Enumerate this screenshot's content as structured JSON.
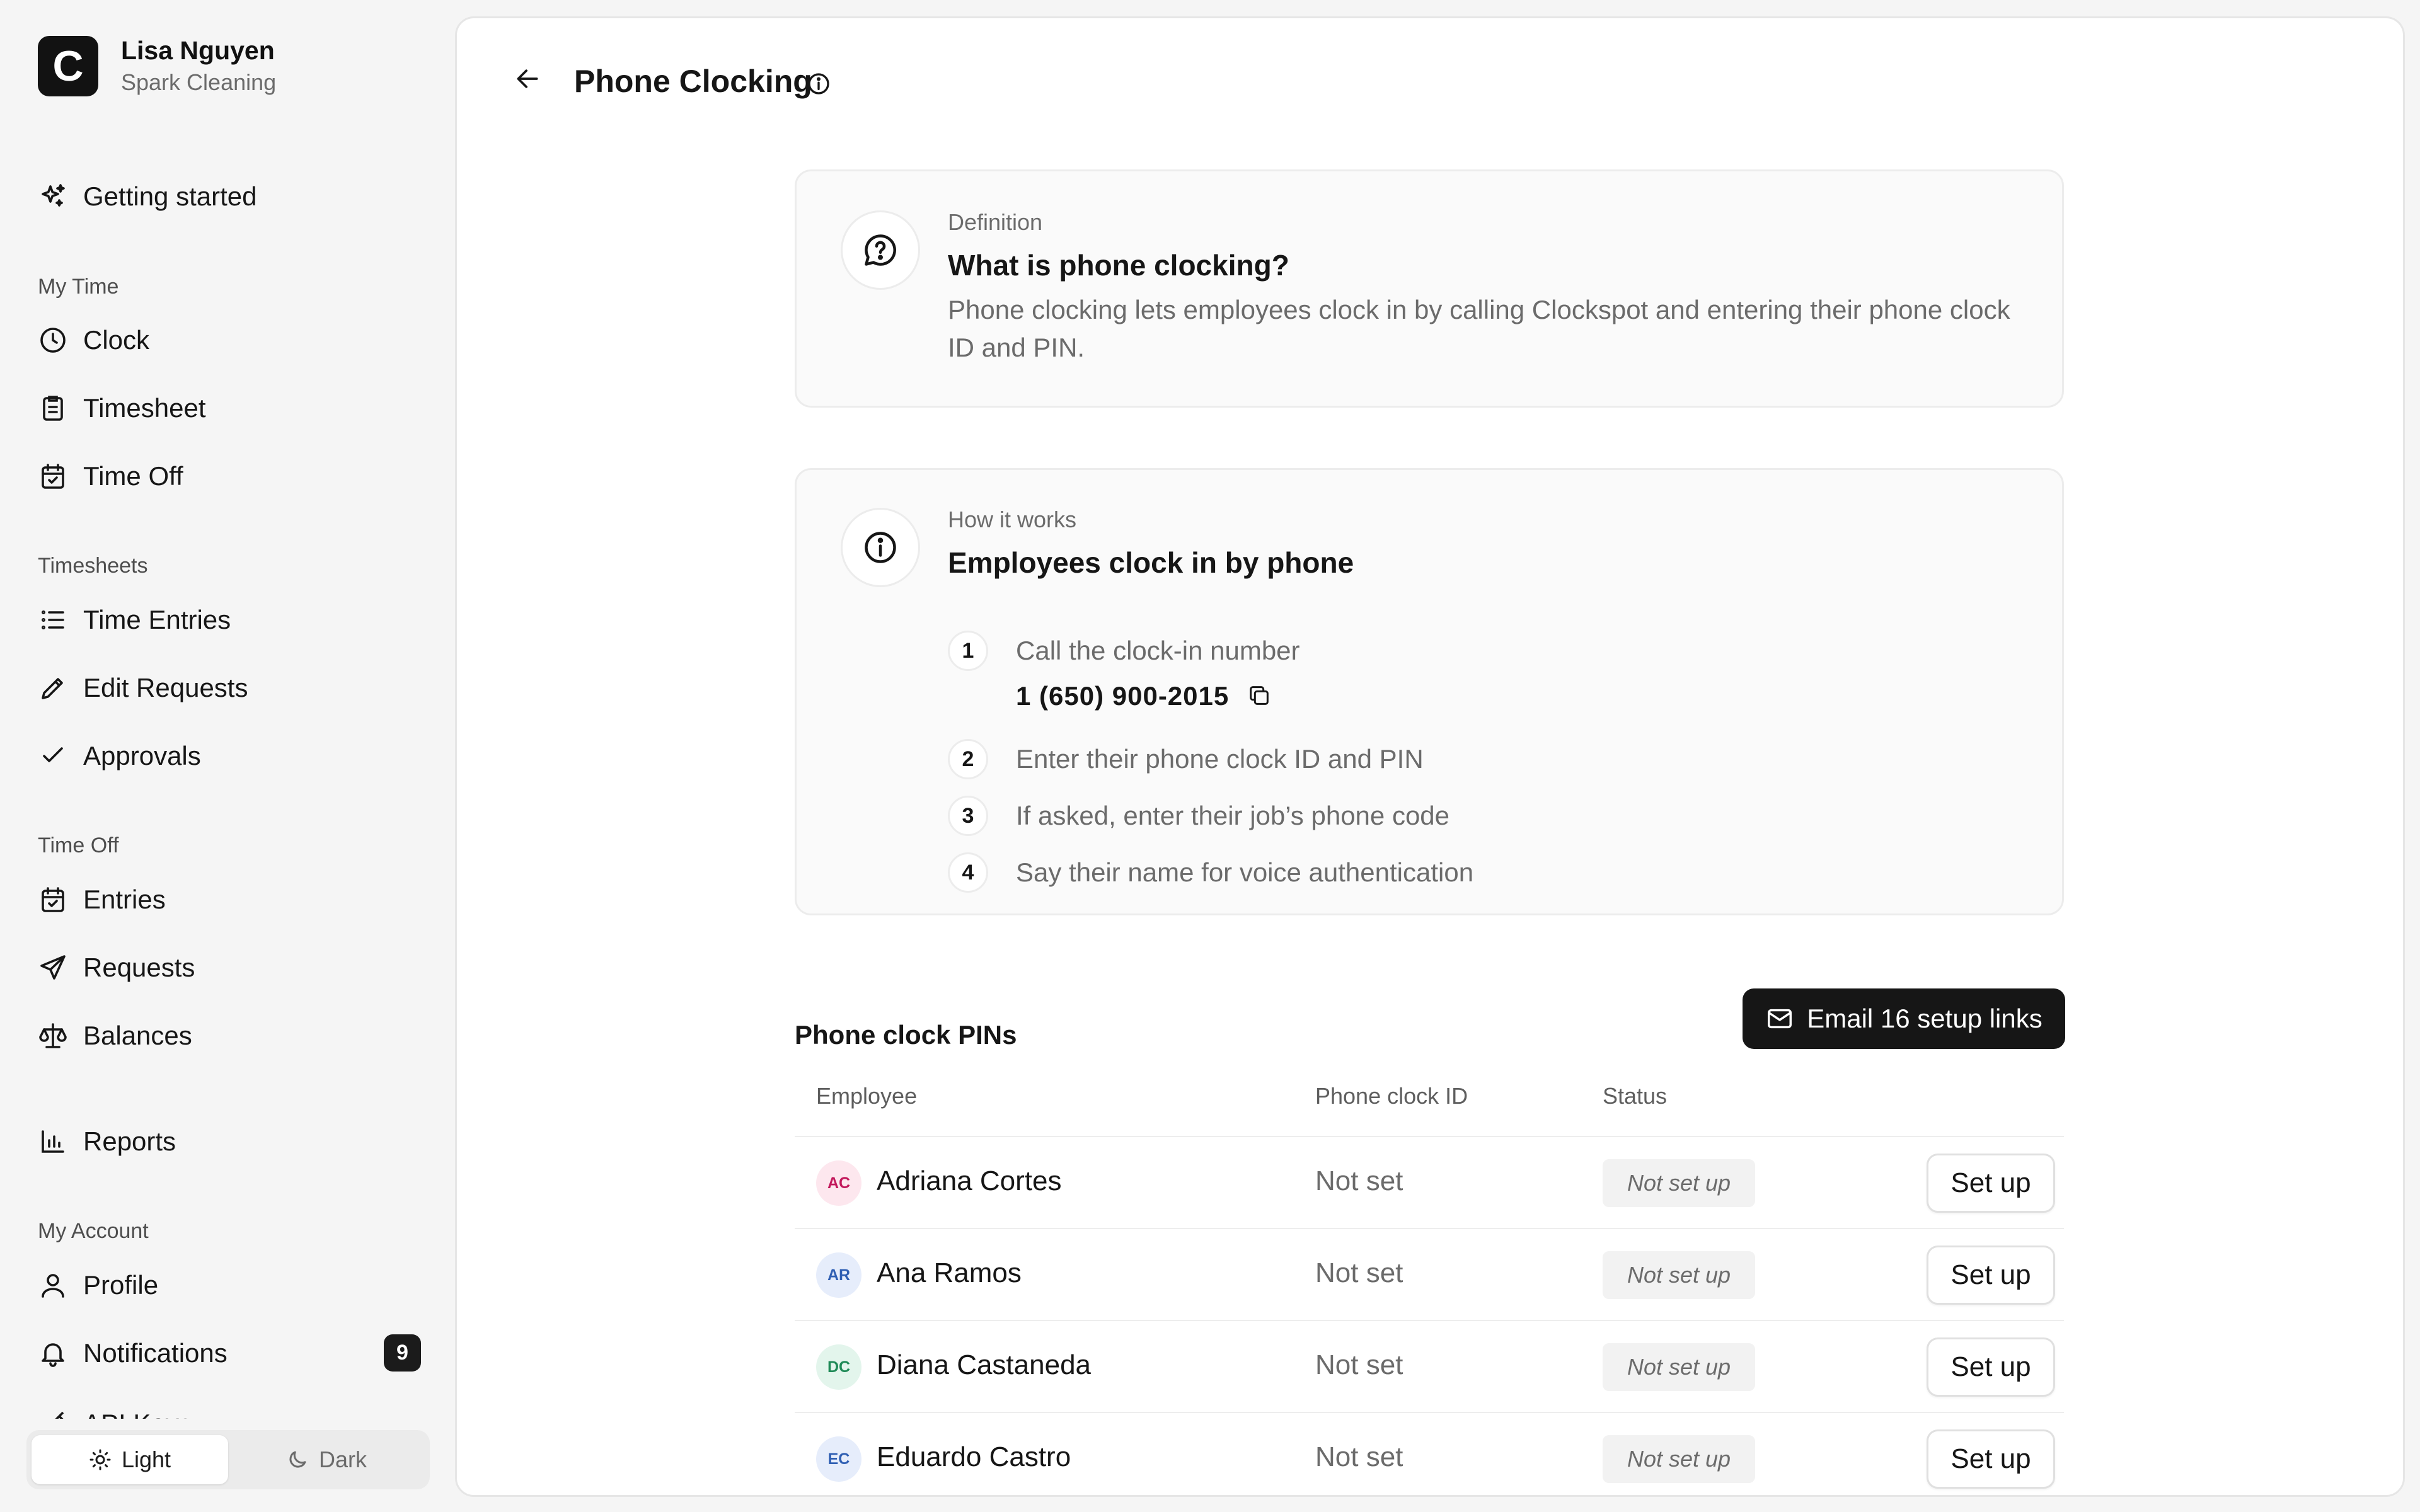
{
  "user": {
    "logo_letter": "C",
    "name": "Lisa Nguyen",
    "company": "Spark Cleaning"
  },
  "sidebar": {
    "getting_started": "Getting started",
    "sections": {
      "my_time": "My Time",
      "timesheets": "Timesheets",
      "time_off": "Time Off",
      "my_account": "My Account"
    },
    "items": {
      "clock": "Clock",
      "timesheet": "Timesheet",
      "time_off": "Time Off",
      "time_entries": "Time Entries",
      "edit_requests": "Edit Requests",
      "approvals": "Approvals",
      "entries": "Entries",
      "requests": "Requests",
      "balances": "Balances",
      "reports": "Reports",
      "profile": "Profile",
      "notifications": "Notifications",
      "api_keys": "API Keys"
    },
    "notifications_count": "9",
    "theme": {
      "light": "Light",
      "dark": "Dark",
      "active": "light"
    }
  },
  "page": {
    "title": "Phone Clocking"
  },
  "definition_card": {
    "eyebrow": "Definition",
    "heading": "What is phone clocking?",
    "body": "Phone clocking lets employees clock in by calling Clockspot and entering their phone clock ID and PIN."
  },
  "how_card": {
    "eyebrow": "How it works",
    "heading": "Employees clock in by phone",
    "steps": [
      {
        "num": "1",
        "text": "Call the clock-in number"
      },
      {
        "num": "2",
        "text": "Enter their phone clock ID and PIN"
      },
      {
        "num": "3",
        "text": "If asked, enter their job’s phone code"
      },
      {
        "num": "4",
        "text": "Say their name for voice authentication"
      }
    ],
    "phone_number": "1 (650) 900-2015"
  },
  "pins": {
    "title": "Phone clock PINs",
    "email_button": "Email 16 setup links",
    "columns": [
      "Employee",
      "Phone clock ID",
      "Status"
    ],
    "rows": [
      {
        "initials": "AC",
        "name": "Adriana Cortes",
        "clock_id": "Not set",
        "status": "Not set up",
        "action": "Set up",
        "avatar_bg": "#fde7ee",
        "avatar_fg": "#c2185b"
      },
      {
        "initials": "AR",
        "name": "Ana Ramos",
        "clock_id": "Not set",
        "status": "Not set up",
        "action": "Set up",
        "avatar_bg": "#e6edfb",
        "avatar_fg": "#2f5fb3"
      },
      {
        "initials": "DC",
        "name": "Diana Castaneda",
        "clock_id": "Not set",
        "status": "Not set up",
        "action": "Set up",
        "avatar_bg": "#e3f5ec",
        "avatar_fg": "#1f8a57"
      },
      {
        "initials": "EC",
        "name": "Eduardo Castro",
        "clock_id": "Not set",
        "status": "Not set up",
        "action": "Set up",
        "avatar_bg": "#e6edfb",
        "avatar_fg": "#2f5fb3"
      }
    ]
  }
}
